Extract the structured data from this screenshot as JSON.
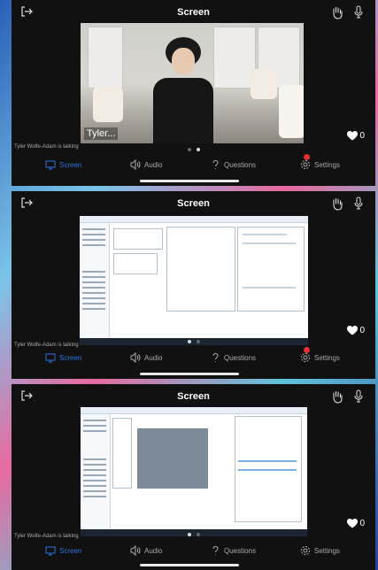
{
  "screens": [
    {
      "title": "Screen",
      "presenter_tag": "Tyler...",
      "likes": "0",
      "talking": "Tyler Wolfe-Adam is talking",
      "tabs": {
        "screen": "Screen",
        "audio": "Audio",
        "questions": "Questions",
        "settings": "Settings"
      },
      "settings_badge": true
    },
    {
      "title": "Screen",
      "likes": "0",
      "talking": "Tyler Wolfe-Adam is talking",
      "tabs": {
        "screen": "Screen",
        "audio": "Audio",
        "questions": "Questions",
        "settings": "Settings"
      },
      "settings_badge": true
    },
    {
      "title": "Screen",
      "likes": "0",
      "talking": "Tyler Wolfe-Adam is talking",
      "tabs": {
        "screen": "Screen",
        "audio": "Audio",
        "questions": "Questions",
        "settings": "Settings"
      },
      "settings_badge": false
    }
  ],
  "icons": {
    "exit": "exit-icon",
    "raise_hand": "raise-hand-icon",
    "mic": "microphone-icon",
    "heart": "heart-icon",
    "screen": "monitor-icon",
    "audio": "speaker-icon",
    "questions": "question-mark-icon",
    "settings": "gear-icon"
  },
  "colors": {
    "active_tab": "#2a74e0",
    "inactive_tab": "#aaaaaa",
    "badge": "#e03030",
    "panel_bg": "#111111"
  }
}
